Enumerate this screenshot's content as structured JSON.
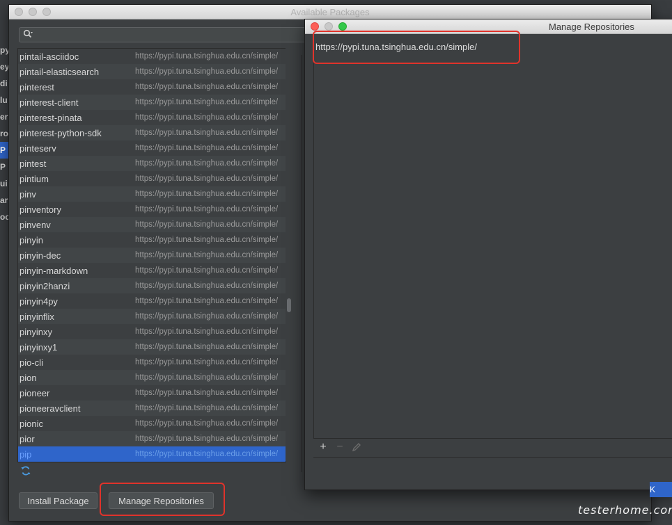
{
  "background": {
    "left_fragments": [
      "py",
      "ey",
      "di",
      "lu",
      "er",
      "ro",
      "P",
      "P",
      "ui",
      "ar",
      "oc"
    ]
  },
  "available_packages": {
    "title": "Available Packages",
    "packages": [
      {
        "name": "pintail-asciidoc",
        "url": "https://pypi.tuna.tsinghua.edu.cn/simple/"
      },
      {
        "name": "pintail-elasticsearch",
        "url": "https://pypi.tuna.tsinghua.edu.cn/simple/"
      },
      {
        "name": "pinterest",
        "url": "https://pypi.tuna.tsinghua.edu.cn/simple/"
      },
      {
        "name": "pinterest-client",
        "url": "https://pypi.tuna.tsinghua.edu.cn/simple/"
      },
      {
        "name": "pinterest-pinata",
        "url": "https://pypi.tuna.tsinghua.edu.cn/simple/"
      },
      {
        "name": "pinterest-python-sdk",
        "url": "https://pypi.tuna.tsinghua.edu.cn/simple/"
      },
      {
        "name": "pinteserv",
        "url": "https://pypi.tuna.tsinghua.edu.cn/simple/"
      },
      {
        "name": "pintest",
        "url": "https://pypi.tuna.tsinghua.edu.cn/simple/"
      },
      {
        "name": "pintium",
        "url": "https://pypi.tuna.tsinghua.edu.cn/simple/"
      },
      {
        "name": "pinv",
        "url": "https://pypi.tuna.tsinghua.edu.cn/simple/"
      },
      {
        "name": "pinventory",
        "url": "https://pypi.tuna.tsinghua.edu.cn/simple/"
      },
      {
        "name": "pinvenv",
        "url": "https://pypi.tuna.tsinghua.edu.cn/simple/"
      },
      {
        "name": "pinyin",
        "url": "https://pypi.tuna.tsinghua.edu.cn/simple/"
      },
      {
        "name": "pinyin-dec",
        "url": "https://pypi.tuna.tsinghua.edu.cn/simple/"
      },
      {
        "name": "pinyin-markdown",
        "url": "https://pypi.tuna.tsinghua.edu.cn/simple/"
      },
      {
        "name": "pinyin2hanzi",
        "url": "https://pypi.tuna.tsinghua.edu.cn/simple/"
      },
      {
        "name": "pinyin4py",
        "url": "https://pypi.tuna.tsinghua.edu.cn/simple/"
      },
      {
        "name": "pinyinflix",
        "url": "https://pypi.tuna.tsinghua.edu.cn/simple/"
      },
      {
        "name": "pinyinxy",
        "url": "https://pypi.tuna.tsinghua.edu.cn/simple/"
      },
      {
        "name": "pinyinxy1",
        "url": "https://pypi.tuna.tsinghua.edu.cn/simple/"
      },
      {
        "name": "pio-cli",
        "url": "https://pypi.tuna.tsinghua.edu.cn/simple/"
      },
      {
        "name": "pion",
        "url": "https://pypi.tuna.tsinghua.edu.cn/simple/"
      },
      {
        "name": "pioneer",
        "url": "https://pypi.tuna.tsinghua.edu.cn/simple/"
      },
      {
        "name": "pioneeravclient",
        "url": "https://pypi.tuna.tsinghua.edu.cn/simple/"
      },
      {
        "name": "pionic",
        "url": "https://pypi.tuna.tsinghua.edu.cn/simple/"
      },
      {
        "name": "pior",
        "url": "https://pypi.tuna.tsinghua.edu.cn/simple/"
      },
      {
        "name": "pip",
        "url": "https://pypi.tuna.tsinghua.edu.cn/simple/",
        "selected": true
      }
    ],
    "buttons": {
      "install": "Install Package",
      "manage": "Manage Repositories"
    }
  },
  "manage_repositories": {
    "title": "Manage Repositories",
    "repositories": [
      "https://pypi.tuna.tsinghua.edu.cn/simple/"
    ],
    "toolbar": {
      "add": "+",
      "remove": "−"
    }
  },
  "edge_button_fragment": "K",
  "watermark": "testerhome.com",
  "colors": {
    "selection": "#2f65ca",
    "highlight_box": "#e0332b",
    "close_button": "#fc5f57",
    "max_button": "#34c84a"
  }
}
